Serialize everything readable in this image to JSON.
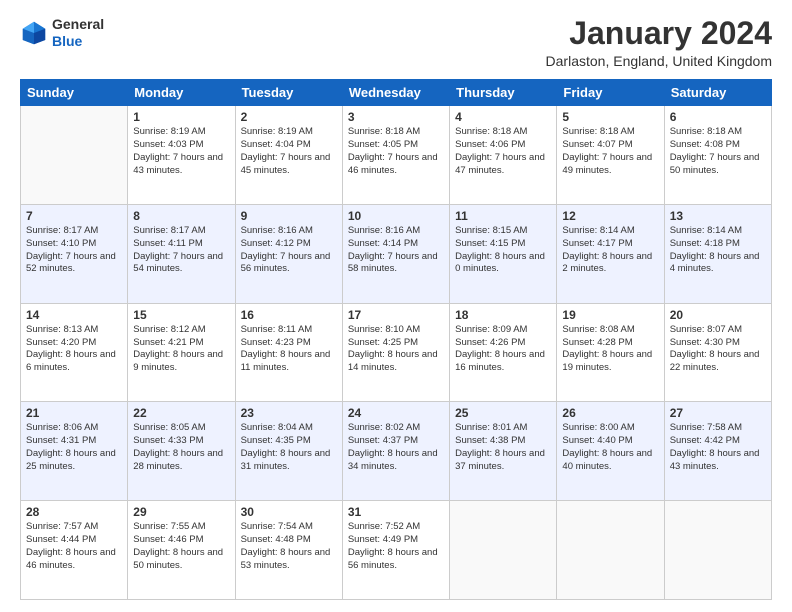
{
  "logo": {
    "general": "General",
    "blue": "Blue"
  },
  "header": {
    "title": "January 2024",
    "location": "Darlaston, England, United Kingdom"
  },
  "days_of_week": [
    "Sunday",
    "Monday",
    "Tuesday",
    "Wednesday",
    "Thursday",
    "Friday",
    "Saturday"
  ],
  "weeks": [
    [
      {
        "day": "",
        "sunrise": "",
        "sunset": "",
        "daylight": ""
      },
      {
        "day": "1",
        "sunrise": "Sunrise: 8:19 AM",
        "sunset": "Sunset: 4:03 PM",
        "daylight": "Daylight: 7 hours and 43 minutes."
      },
      {
        "day": "2",
        "sunrise": "Sunrise: 8:19 AM",
        "sunset": "Sunset: 4:04 PM",
        "daylight": "Daylight: 7 hours and 45 minutes."
      },
      {
        "day": "3",
        "sunrise": "Sunrise: 8:18 AM",
        "sunset": "Sunset: 4:05 PM",
        "daylight": "Daylight: 7 hours and 46 minutes."
      },
      {
        "day": "4",
        "sunrise": "Sunrise: 8:18 AM",
        "sunset": "Sunset: 4:06 PM",
        "daylight": "Daylight: 7 hours and 47 minutes."
      },
      {
        "day": "5",
        "sunrise": "Sunrise: 8:18 AM",
        "sunset": "Sunset: 4:07 PM",
        "daylight": "Daylight: 7 hours and 49 minutes."
      },
      {
        "day": "6",
        "sunrise": "Sunrise: 8:18 AM",
        "sunset": "Sunset: 4:08 PM",
        "daylight": "Daylight: 7 hours and 50 minutes."
      }
    ],
    [
      {
        "day": "7",
        "sunrise": "Sunrise: 8:17 AM",
        "sunset": "Sunset: 4:10 PM",
        "daylight": "Daylight: 7 hours and 52 minutes."
      },
      {
        "day": "8",
        "sunrise": "Sunrise: 8:17 AM",
        "sunset": "Sunset: 4:11 PM",
        "daylight": "Daylight: 7 hours and 54 minutes."
      },
      {
        "day": "9",
        "sunrise": "Sunrise: 8:16 AM",
        "sunset": "Sunset: 4:12 PM",
        "daylight": "Daylight: 7 hours and 56 minutes."
      },
      {
        "day": "10",
        "sunrise": "Sunrise: 8:16 AM",
        "sunset": "Sunset: 4:14 PM",
        "daylight": "Daylight: 7 hours and 58 minutes."
      },
      {
        "day": "11",
        "sunrise": "Sunrise: 8:15 AM",
        "sunset": "Sunset: 4:15 PM",
        "daylight": "Daylight: 8 hours and 0 minutes."
      },
      {
        "day": "12",
        "sunrise": "Sunrise: 8:14 AM",
        "sunset": "Sunset: 4:17 PM",
        "daylight": "Daylight: 8 hours and 2 minutes."
      },
      {
        "day": "13",
        "sunrise": "Sunrise: 8:14 AM",
        "sunset": "Sunset: 4:18 PM",
        "daylight": "Daylight: 8 hours and 4 minutes."
      }
    ],
    [
      {
        "day": "14",
        "sunrise": "Sunrise: 8:13 AM",
        "sunset": "Sunset: 4:20 PM",
        "daylight": "Daylight: 8 hours and 6 minutes."
      },
      {
        "day": "15",
        "sunrise": "Sunrise: 8:12 AM",
        "sunset": "Sunset: 4:21 PM",
        "daylight": "Daylight: 8 hours and 9 minutes."
      },
      {
        "day": "16",
        "sunrise": "Sunrise: 8:11 AM",
        "sunset": "Sunset: 4:23 PM",
        "daylight": "Daylight: 8 hours and 11 minutes."
      },
      {
        "day": "17",
        "sunrise": "Sunrise: 8:10 AM",
        "sunset": "Sunset: 4:25 PM",
        "daylight": "Daylight: 8 hours and 14 minutes."
      },
      {
        "day": "18",
        "sunrise": "Sunrise: 8:09 AM",
        "sunset": "Sunset: 4:26 PM",
        "daylight": "Daylight: 8 hours and 16 minutes."
      },
      {
        "day": "19",
        "sunrise": "Sunrise: 8:08 AM",
        "sunset": "Sunset: 4:28 PM",
        "daylight": "Daylight: 8 hours and 19 minutes."
      },
      {
        "day": "20",
        "sunrise": "Sunrise: 8:07 AM",
        "sunset": "Sunset: 4:30 PM",
        "daylight": "Daylight: 8 hours and 22 minutes."
      }
    ],
    [
      {
        "day": "21",
        "sunrise": "Sunrise: 8:06 AM",
        "sunset": "Sunset: 4:31 PM",
        "daylight": "Daylight: 8 hours and 25 minutes."
      },
      {
        "day": "22",
        "sunrise": "Sunrise: 8:05 AM",
        "sunset": "Sunset: 4:33 PM",
        "daylight": "Daylight: 8 hours and 28 minutes."
      },
      {
        "day": "23",
        "sunrise": "Sunrise: 8:04 AM",
        "sunset": "Sunset: 4:35 PM",
        "daylight": "Daylight: 8 hours and 31 minutes."
      },
      {
        "day": "24",
        "sunrise": "Sunrise: 8:02 AM",
        "sunset": "Sunset: 4:37 PM",
        "daylight": "Daylight: 8 hours and 34 minutes."
      },
      {
        "day": "25",
        "sunrise": "Sunrise: 8:01 AM",
        "sunset": "Sunset: 4:38 PM",
        "daylight": "Daylight: 8 hours and 37 minutes."
      },
      {
        "day": "26",
        "sunrise": "Sunrise: 8:00 AM",
        "sunset": "Sunset: 4:40 PM",
        "daylight": "Daylight: 8 hours and 40 minutes."
      },
      {
        "day": "27",
        "sunrise": "Sunrise: 7:58 AM",
        "sunset": "Sunset: 4:42 PM",
        "daylight": "Daylight: 8 hours and 43 minutes."
      }
    ],
    [
      {
        "day": "28",
        "sunrise": "Sunrise: 7:57 AM",
        "sunset": "Sunset: 4:44 PM",
        "daylight": "Daylight: 8 hours and 46 minutes."
      },
      {
        "day": "29",
        "sunrise": "Sunrise: 7:55 AM",
        "sunset": "Sunset: 4:46 PM",
        "daylight": "Daylight: 8 hours and 50 minutes."
      },
      {
        "day": "30",
        "sunrise": "Sunrise: 7:54 AM",
        "sunset": "Sunset: 4:48 PM",
        "daylight": "Daylight: 8 hours and 53 minutes."
      },
      {
        "day": "31",
        "sunrise": "Sunrise: 7:52 AM",
        "sunset": "Sunset: 4:49 PM",
        "daylight": "Daylight: 8 hours and 56 minutes."
      },
      {
        "day": "",
        "sunrise": "",
        "sunset": "",
        "daylight": ""
      },
      {
        "day": "",
        "sunrise": "",
        "sunset": "",
        "daylight": ""
      },
      {
        "day": "",
        "sunrise": "",
        "sunset": "",
        "daylight": ""
      }
    ]
  ]
}
